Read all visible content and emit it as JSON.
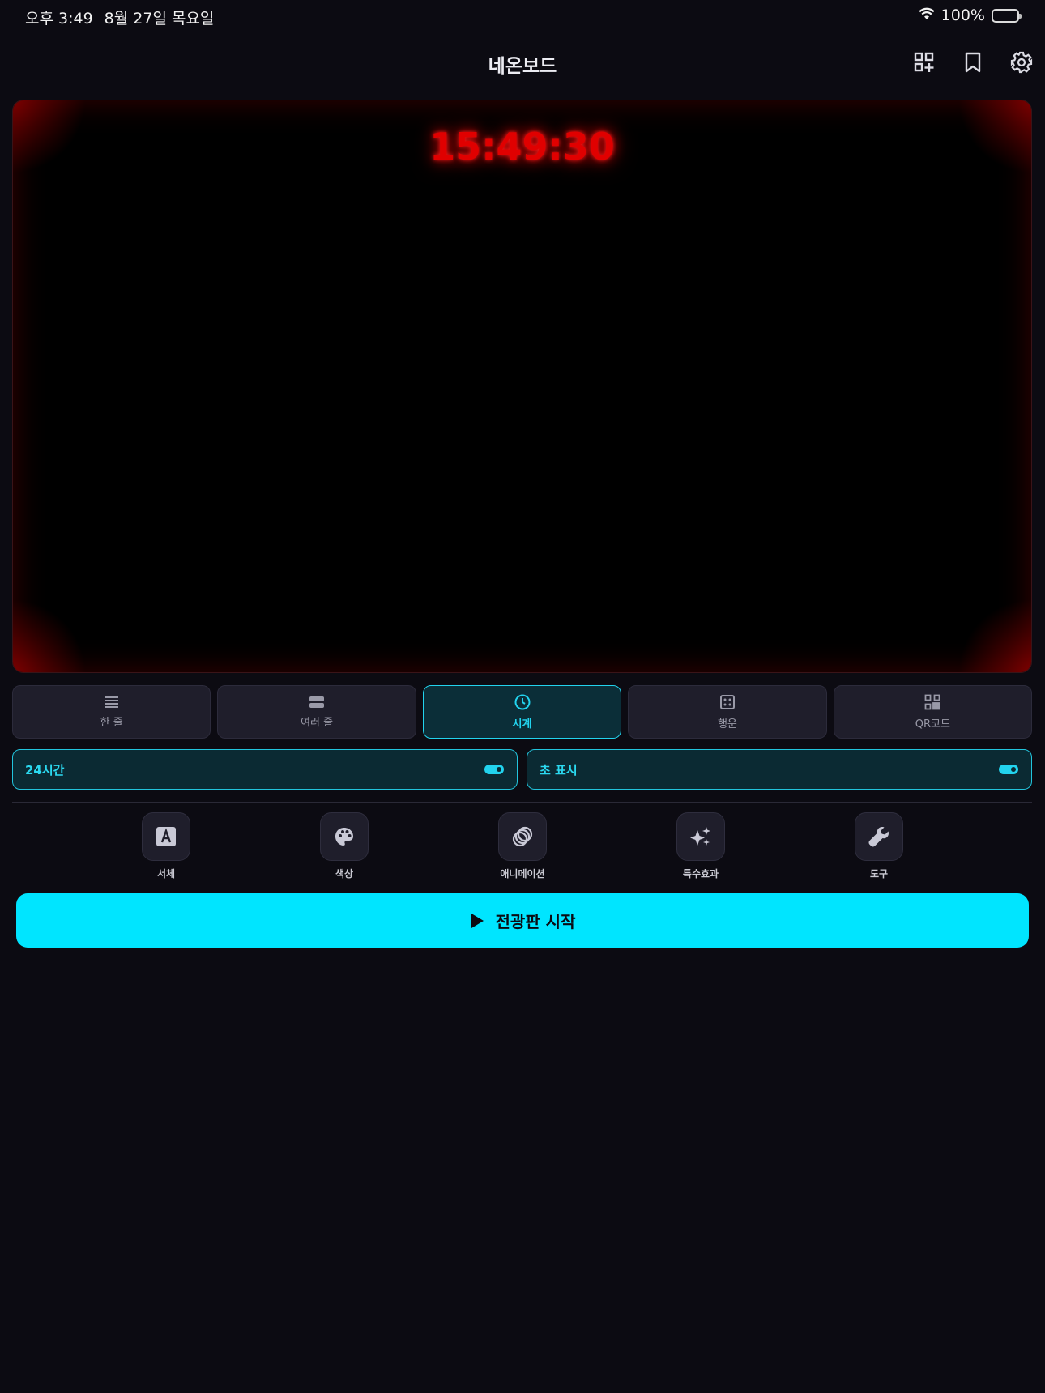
{
  "status_bar": {
    "time": "오후 3:49",
    "date": "8월 27일 목요일",
    "battery": "100%"
  },
  "header": {
    "title": "네온보드",
    "icons": [
      "qr-add-icon",
      "bookmark-icon",
      "gear-icon"
    ]
  },
  "board": {
    "clock_text": "15:49:30",
    "text_color": "#e00000"
  },
  "mode_tabs": [
    {
      "label": "한 줄",
      "icon": "lines-icon",
      "active": false
    },
    {
      "label": "여러 줄",
      "icon": "rows-icon",
      "active": false
    },
    {
      "label": "시계",
      "icon": "clock-icon",
      "active": true
    },
    {
      "label": "행운",
      "icon": "dice-icon",
      "active": false
    },
    {
      "label": "QR코드",
      "icon": "qr-code-icon",
      "active": false
    }
  ],
  "toggles": [
    {
      "label": "24시간",
      "on": true
    },
    {
      "label": "초 표시",
      "on": true
    }
  ],
  "tools": [
    {
      "label": "서체",
      "icon": "font-icon"
    },
    {
      "label": "색상",
      "icon": "palette-icon"
    },
    {
      "label": "애니메이션",
      "icon": "animation-icon"
    },
    {
      "label": "특수효과",
      "icon": "sparkle-icon"
    },
    {
      "label": "도구",
      "icon": "wrench-icon"
    }
  ],
  "start_button": {
    "label": "전광판 시작",
    "icon": "play-icon"
  },
  "colors": {
    "accent": "#00e5ff",
    "background": "#0c0b12",
    "active_tab": "#0b2e38"
  }
}
